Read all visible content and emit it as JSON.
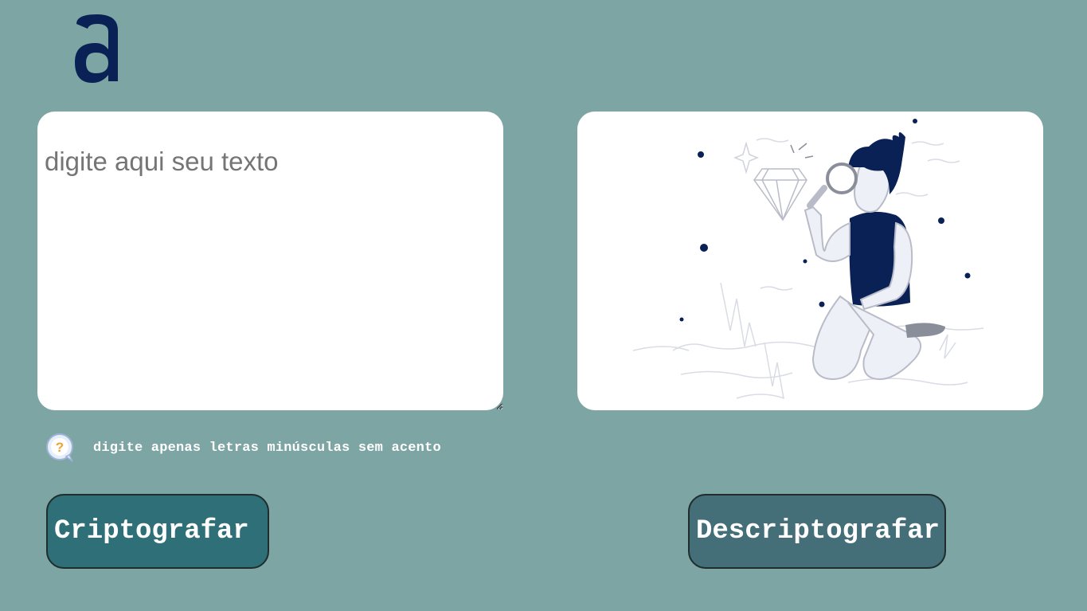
{
  "logo": {
    "icon": "alura-a-logo-icon",
    "color": "#0a2156"
  },
  "input": {
    "placeholder": "digite aqui seu texto",
    "value": ""
  },
  "output": {
    "illustration": "person-with-magnifying-glass-illustration",
    "accent": "#0a2156"
  },
  "hint": {
    "icon": "question-bubble-icon",
    "text": "digite apenas letras minúsculas sem acento"
  },
  "buttons": {
    "encrypt_label": "Criptografar",
    "decrypt_label": "Descriptografar"
  },
  "colors": {
    "background": "#7ca5a3",
    "encrypt_button": "#2e6f78",
    "decrypt_button": "#446e78",
    "card": "#ffffff"
  }
}
